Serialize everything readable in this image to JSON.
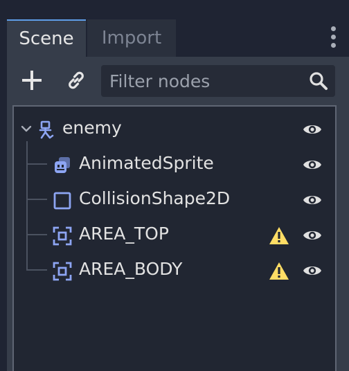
{
  "tabs": [
    {
      "label": "Scene",
      "active": true
    },
    {
      "label": "Import",
      "active": false
    }
  ],
  "toolbar": {
    "add_icon": "plus-icon",
    "link_icon": "link-icon",
    "filter_placeholder": "Filter nodes",
    "filter_value": "",
    "search_icon": "search-icon"
  },
  "tree": {
    "nodes": [
      {
        "name": "enemy",
        "icon": "kinematic-body-2d-icon",
        "depth": 0,
        "expanded": true,
        "warning": false,
        "visible": true
      },
      {
        "name": "AnimatedSprite",
        "icon": "animated-sprite-icon",
        "depth": 1,
        "warning": false,
        "visible": true
      },
      {
        "name": "CollisionShape2D",
        "icon": "collision-shape-2d-icon",
        "depth": 1,
        "warning": false,
        "visible": true
      },
      {
        "name": "AREA_TOP",
        "icon": "area-2d-icon",
        "depth": 1,
        "warning": true,
        "visible": true
      },
      {
        "name": "AREA_BODY",
        "icon": "area-2d-icon",
        "depth": 1,
        "warning": true,
        "visible": true
      }
    ]
  },
  "colors": {
    "accent": "#5f9ee8",
    "node_icon": "#8da5f3",
    "warning": "#ffdd65",
    "eye": "#e0e0e0"
  }
}
